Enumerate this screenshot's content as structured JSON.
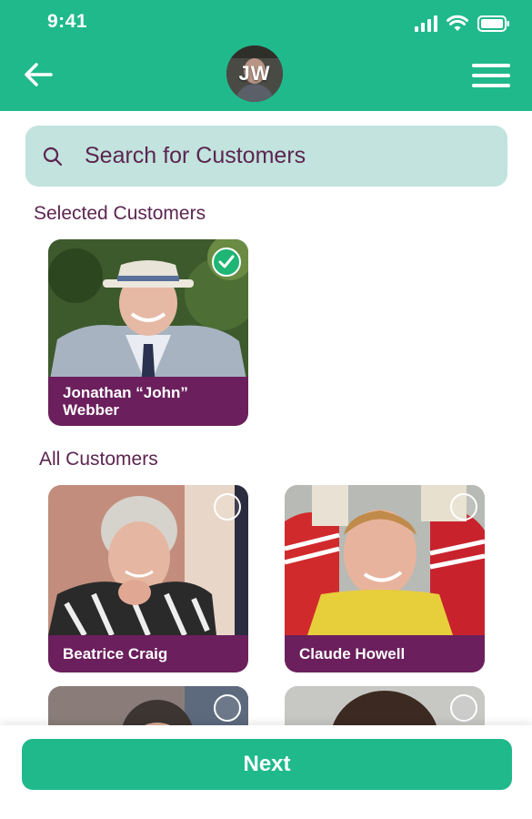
{
  "status_bar": {
    "time": "9:41"
  },
  "header": {
    "back_icon": "arrow-left-icon",
    "avatar_initials": "JW",
    "menu_icon": "hamburger-menu-icon"
  },
  "search": {
    "placeholder": "Search for Customers",
    "icon": "search-icon"
  },
  "selected_section": {
    "label": "Selected Customers",
    "customers": [
      {
        "name": "Jonathan “John” Webber",
        "selected": true
      }
    ]
  },
  "all_section": {
    "label": "All Customers",
    "customers": [
      {
        "name": "Beatrice Craig",
        "selected": false
      },
      {
        "name": "Claude Howell",
        "selected": false
      },
      {
        "name": "",
        "selected": false
      },
      {
        "name": "",
        "selected": false
      }
    ]
  },
  "footer": {
    "next_label": "Next"
  },
  "colors": {
    "brand_green": "#20b98c",
    "name_bar_purple": "#6b1f5c",
    "search_bg": "#c2e3de",
    "check_green": "#1fb574"
  }
}
